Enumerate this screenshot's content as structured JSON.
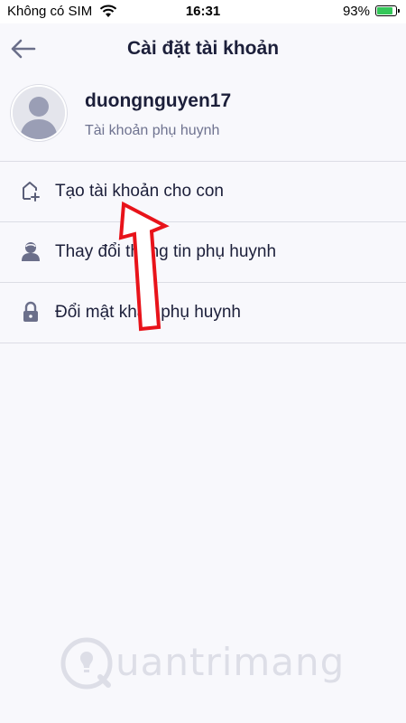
{
  "status_bar": {
    "carrier": "Không có SIM",
    "time": "16:31",
    "battery": "93%",
    "battery_level": 0.93
  },
  "header": {
    "title": "Cài đặt tài khoản",
    "back_icon": "arrow-left-icon"
  },
  "profile": {
    "username": "duongnguyen17",
    "role": "Tài khoản phụ huynh",
    "avatar_icon": "user-avatar-icon"
  },
  "menu": {
    "items": [
      {
        "label": "Tạo tài khoản cho con",
        "icon": "house-add-icon"
      },
      {
        "label": "Thay đổi thông tin phụ huynh",
        "icon": "user-icon"
      },
      {
        "label": "Đổi mật khẩu phụ huynh",
        "icon": "lock-icon"
      }
    ]
  },
  "watermark": {
    "text": "uantrimang"
  },
  "colors": {
    "text_primary": "#1c1f3a",
    "text_secondary": "#6f7390",
    "icon": "#6b6f8a",
    "annotation_arrow": "#e8131a"
  }
}
